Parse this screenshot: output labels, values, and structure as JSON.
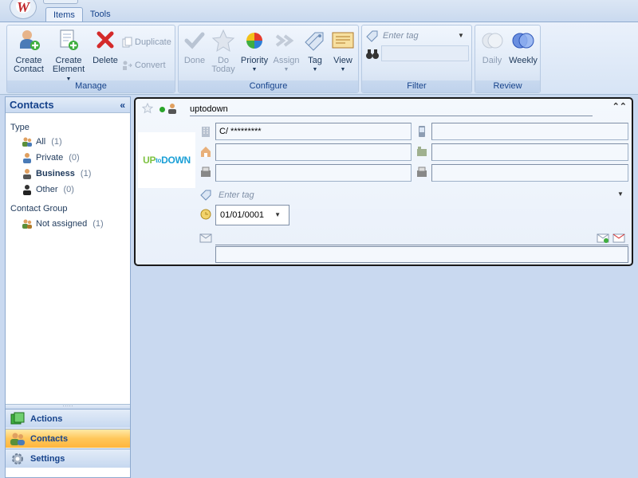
{
  "app": {
    "logo_letter": "W"
  },
  "tabs": [
    {
      "label": "Items",
      "active": true
    },
    {
      "label": "Tools",
      "active": false
    }
  ],
  "ribbon": {
    "manage": {
      "label": "Manage",
      "create_contact": [
        "Create",
        "Contact"
      ],
      "create_element": [
        "Create",
        "Element"
      ],
      "delete": "Delete",
      "duplicate": "Duplicate",
      "convert": "Convert"
    },
    "configure": {
      "label": "Configure",
      "done": "Done",
      "do_today": [
        "Do",
        "Today"
      ],
      "priority": "Priority",
      "assign": "Assign",
      "tag": "Tag",
      "view": "View"
    },
    "filter": {
      "label": "Filter",
      "tag_placeholder": "Enter tag"
    },
    "review": {
      "label": "Review",
      "daily": "Daily",
      "weekly": "Weekly"
    }
  },
  "left_pane": {
    "title": "Contacts",
    "type_section": "Type",
    "types": [
      {
        "label": "All",
        "count": "(1)",
        "bold": false
      },
      {
        "label": "Private",
        "count": "(0)",
        "bold": false
      },
      {
        "label": "Business",
        "count": "(1)",
        "bold": true
      },
      {
        "label": "Other",
        "count": "(0)",
        "bold": false
      }
    ],
    "group_section": "Contact Group",
    "groups": [
      {
        "label": "Not assigned",
        "count": "(1)"
      }
    ],
    "nav": [
      {
        "label": "Actions",
        "active": false
      },
      {
        "label": "Contacts",
        "active": true
      },
      {
        "label": "Settings",
        "active": false
      }
    ]
  },
  "card": {
    "name": "uptodown",
    "logo": {
      "part1": "UP",
      "part2": "to",
      "part3": "DOWN"
    },
    "address": "C/ *********",
    "mobile": "",
    "home_phone": "",
    "work_phone": "",
    "fax": "",
    "fax2": "",
    "tag_placeholder": "Enter tag",
    "date": "01/01/0001",
    "notes": ""
  },
  "colors": {
    "accent": "#15428b",
    "active_nav": "#ffc75a",
    "ribbon_bg": "#dde8f6"
  }
}
